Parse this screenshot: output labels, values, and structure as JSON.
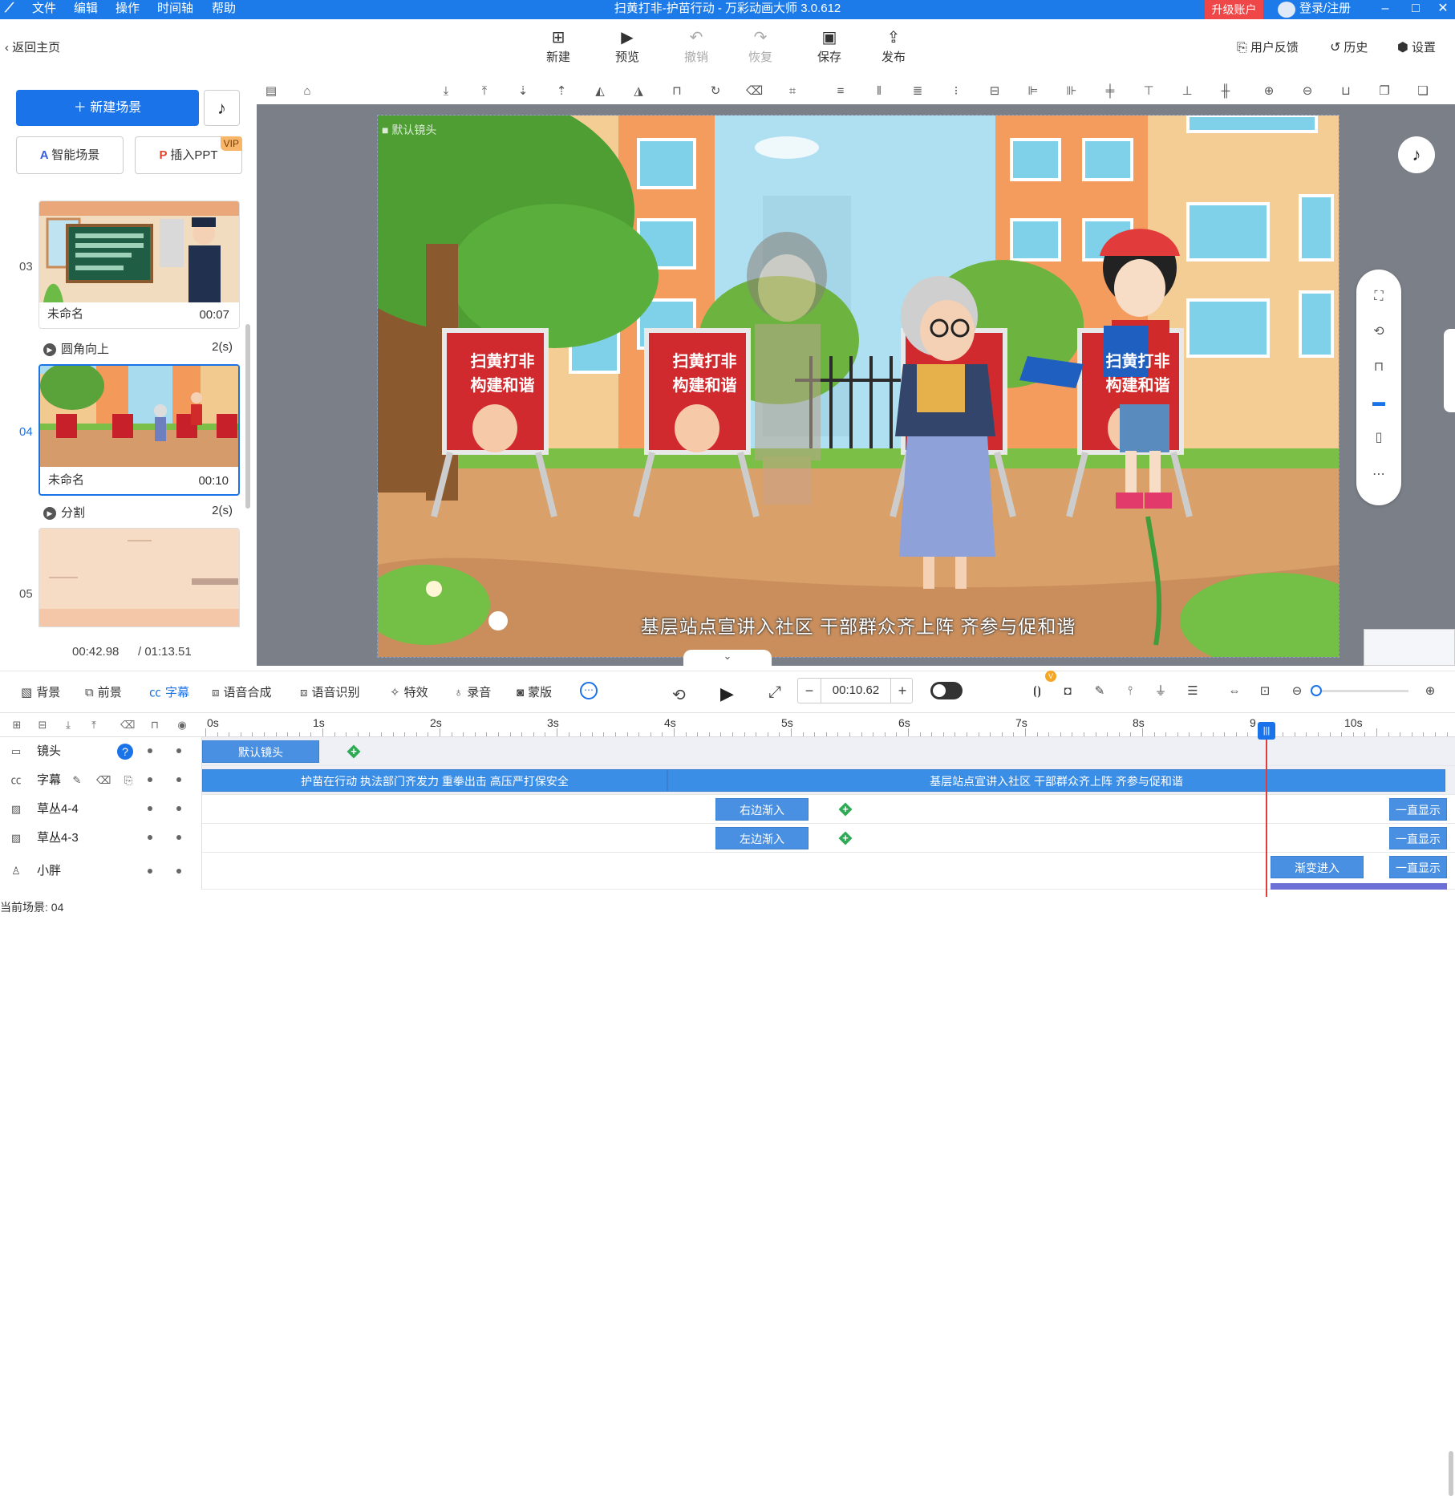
{
  "window": {
    "title": "扫黄打非-护苗行动 - 万彩动画大师 3.0.612",
    "menu": [
      "文件",
      "编辑",
      "操作",
      "时间轴",
      "帮助"
    ],
    "upgrade": "升级账户",
    "login": "登录/注册",
    "accent": "#1c7be9"
  },
  "toolbar": {
    "back": "返回主页",
    "buttons": [
      "新建",
      "预览",
      "撤销",
      "恢复",
      "保存",
      "发布"
    ],
    "feedback": "用户反馈",
    "history": "历史",
    "settings": "设置"
  },
  "left": {
    "new_scene": "新建场景",
    "smart_scene": "智能场景",
    "insert_ppt": "插入PPT",
    "vip": "VIP",
    "scenes": [
      {
        "num": "03",
        "name": "未命名",
        "time": "00:07"
      },
      {
        "num": "04",
        "name": "未命名",
        "time": "00:10"
      },
      {
        "num": "05",
        "name": "",
        "time": ""
      }
    ],
    "transitions": [
      {
        "name": "圆角向上",
        "dur": "2(s)"
      },
      {
        "name": "分割",
        "dur": "2(s)"
      }
    ],
    "time_current": "00:42.98",
    "time_total": "/ 01:13.51"
  },
  "stage": {
    "camera_label": "默认镜头",
    "subtitle": "基层站点宣讲入社区 干部群众齐上阵 齐参与促和谐",
    "board_text_1": "扫黄打非",
    "board_text_2": "构建和谐"
  },
  "bottom": {
    "tools": [
      "背景",
      "前景",
      "字幕",
      "语音合成",
      "语音识别",
      "特效",
      "录音",
      "蒙版"
    ],
    "time": "00:10.62",
    "v_badge": "V"
  },
  "timeline": {
    "ticks": [
      "0s",
      "1s",
      "2s",
      "3s",
      "4s",
      "5s",
      "6s",
      "7s",
      "8s",
      "9",
      "10s"
    ],
    "tracks": [
      {
        "name": "镜头",
        "icon": "camera-icon"
      },
      {
        "name": "字幕",
        "icon": "subtitle-icon"
      },
      {
        "name": "草丛4-4",
        "icon": "image-icon"
      },
      {
        "name": "草丛4-3",
        "icon": "image-icon"
      },
      {
        "name": "小胖",
        "icon": "person-icon"
      }
    ],
    "clips": {
      "camera": "默认镜头",
      "sub1": "护苗在行动 执法部门齐发力 重拳出击 高压严打保安全",
      "sub2": "基层站点宣讲入社区 干部群众齐上阵 齐参与促和谐",
      "grass44_in": "右边渐入",
      "grass43_in": "左边渐入",
      "always": "一直显示",
      "fade_in": "渐变进入"
    },
    "current_scene": "当前场景: 04"
  }
}
